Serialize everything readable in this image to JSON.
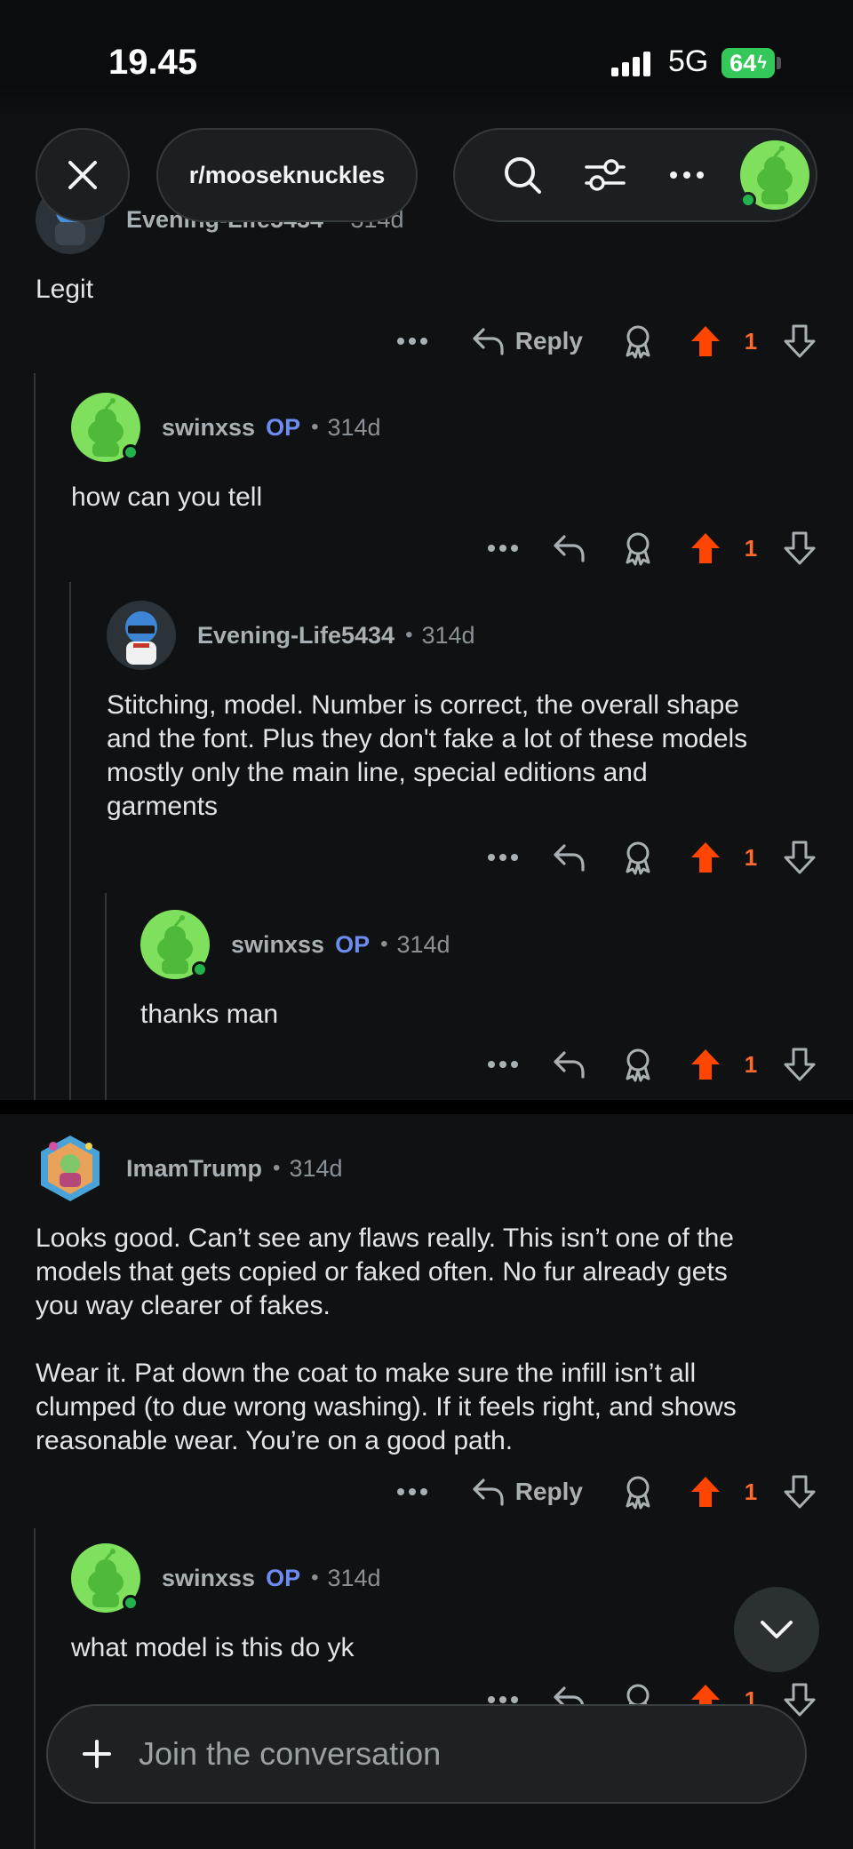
{
  "status": {
    "time": "19.45",
    "network": "5G",
    "battery": "64"
  },
  "nav": {
    "subreddit": "r/mooseknuckles"
  },
  "threads": [
    {
      "comments": [
        {
          "user": "Evening-Life5434",
          "op": "",
          "age": "314d",
          "body": "Legit",
          "votes": "1",
          "reply_label": "Reply"
        },
        {
          "user": "swinxss",
          "op": "OP",
          "age": "314d",
          "body": "how can you tell",
          "votes": "1"
        },
        {
          "user": "Evening-Life5434",
          "op": "",
          "age": "314d",
          "body": "Stitching, model. Number is correct, the overall shape\nand the font. Plus they don't fake a lot of these models\nmostly only the main line, special editions and\ngarments",
          "votes": "1"
        },
        {
          "user": "swinxss",
          "op": "OP",
          "age": "314d",
          "body": "thanks man",
          "votes": "1"
        }
      ]
    },
    {
      "comments": [
        {
          "user": "ImamTrump",
          "op": "",
          "age": "314d",
          "body": "Looks good. Can’t see any flaws really. This isn’t one of the\nmodels that gets copied or faked often. No fur already gets\nyou way clearer of fakes.\n\nWear it. Pat down the coat to make sure the infill isn’t all\nclumped (to due wrong washing). If it feels right, and shows\nreasonable wear. You’re on a good path.",
          "votes": "1",
          "reply_label": "Reply"
        },
        {
          "user": "swinxss",
          "op": "OP",
          "age": "314d",
          "body": "what model is this do yk",
          "votes": "1"
        }
      ]
    }
  ],
  "composer": {
    "placeholder": "Join the conversation"
  },
  "colors": {
    "background": "#0f1112",
    "upvote": "#ff4500",
    "op": "#6d8cf2",
    "online": "#22b14c"
  },
  "icons": [
    "close-icon",
    "search-icon",
    "filter-icon",
    "more-icon",
    "reply-icon",
    "award-icon",
    "upvote-icon",
    "downvote-icon",
    "plus-icon",
    "chevron-down-icon"
  ]
}
